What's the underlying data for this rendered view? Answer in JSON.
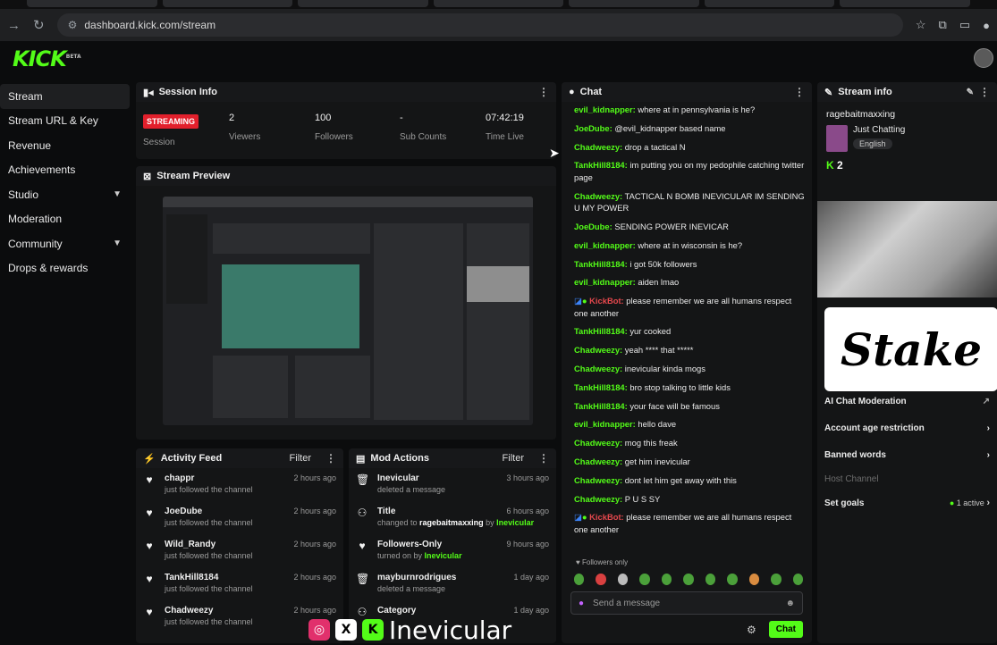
{
  "browser": {
    "url": "dashboard.kick.com/stream"
  },
  "brand": {
    "logo": "KICK",
    "beta": "BETA",
    "accent": "#53fc18"
  },
  "sidebar": {
    "items": [
      {
        "label": "Stream"
      },
      {
        "label": "Stream URL & Key"
      },
      {
        "label": "Revenue"
      },
      {
        "label": "Achievements"
      },
      {
        "label": "Studio"
      },
      {
        "label": "Moderation"
      },
      {
        "label": "Community"
      },
      {
        "label": "Drops & rewards"
      }
    ]
  },
  "session": {
    "title": "Session Info",
    "badge": "STREAMING",
    "session_label": "Session",
    "viewers": "2",
    "viewers_label": "Viewers",
    "followers": "100",
    "followers_label": "Followers",
    "subs": "-",
    "subs_label": "Sub Counts",
    "time": "07:42:19",
    "time_label": "Time Live"
  },
  "preview": {
    "title": "Stream Preview"
  },
  "activity": {
    "title": "Activity Feed",
    "filter": "Filter",
    "rows": [
      {
        "name": "chappr",
        "sub": "just followed the channel",
        "time": "2 hours ago"
      },
      {
        "name": "JoeDube",
        "sub": "just followed the channel",
        "time": "2 hours ago"
      },
      {
        "name": "Wild_Randy",
        "sub": "just followed the channel",
        "time": "2 hours ago"
      },
      {
        "name": "TankHill8184",
        "sub": "just followed the channel",
        "time": "2 hours ago"
      },
      {
        "name": "Chadweezy",
        "sub": "just followed the channel",
        "time": "2 hours ago"
      }
    ]
  },
  "mod": {
    "title": "Mod Actions",
    "filter": "Filter",
    "rows": [
      {
        "name": "Inevicular",
        "sub": "deleted a message",
        "time": "3 hours ago"
      },
      {
        "name": "Title",
        "sub_a": "changed to ",
        "sub_b": "ragebaitmaxxing",
        "sub_c": " by ",
        "sub_d": "Inevicular",
        "time": "6 hours ago"
      },
      {
        "name": "Followers-Only",
        "sub_a": "turned on by ",
        "sub_d": "Inevicular",
        "time": "9 hours ago"
      },
      {
        "name": "mayburnrodrigues",
        "sub": "deleted a message",
        "time": "1 day ago"
      },
      {
        "name": "Category",
        "sub": "",
        "time": "1 day ago"
      }
    ]
  },
  "chat": {
    "title": "Chat",
    "messages": [
      {
        "user": "evil_kidnapper:",
        "text": " where at in pennsylvania is he?"
      },
      {
        "user": "JoeDube:",
        "text": " @evil_kidnapper based name"
      },
      {
        "user": "Chadweezy:",
        "text": " drop a tactical N"
      },
      {
        "user": "TankHill8184:",
        "text": " im putting you on my pedophile catching twitter page"
      },
      {
        "user": "Chadweezy:",
        "text": " TACTICAL N BOMB INEVICULAR IM SENDING U MY POWER"
      },
      {
        "user": "JoeDube:",
        "text": " SENDING POWER INEVICAR"
      },
      {
        "user": "evil_kidnapper:",
        "text": " where at in wisconsin is he?"
      },
      {
        "user": "TankHill8184:",
        "text": " i got 50k followers"
      },
      {
        "user": "evil_kidnapper:",
        "text": " aiden lmao"
      },
      {
        "user": "KickBot:",
        "text": " please remember we are all humans respect one another",
        "bot": true
      },
      {
        "user": "TankHill8184:",
        "text": " yur cooked"
      },
      {
        "user": "Chadweezy:",
        "text": " yeah **** that *****"
      },
      {
        "user": "Chadweezy:",
        "text": " inevicular kinda mogs"
      },
      {
        "user": "TankHill8184:",
        "text": " bro stop talking to little kids"
      },
      {
        "user": "TankHill8184:",
        "text": " your face will be famous"
      },
      {
        "user": "evil_kidnapper:",
        "text": " hello dave"
      },
      {
        "user": "Chadweezy:",
        "text": " mog this freak"
      },
      {
        "user": "Chadweezy:",
        "text": " get him inevicular"
      },
      {
        "user": "Chadweezy:",
        "text": " dont let him get away with this"
      },
      {
        "user": "Chadweezy:",
        "text": " P U S SY"
      },
      {
        "user": "KickBot:",
        "text": " please remember we are all humans respect one another",
        "bot": true
      }
    ],
    "followers_only": "Followers only",
    "placeholder": "Send a message",
    "send": "Chat"
  },
  "stream_info": {
    "title": "Stream info",
    "channel": "ragebaitmaxxing",
    "category": "Just Chatting",
    "language": "English",
    "viewer_count": "2",
    "rows": [
      {
        "label": "AI Chat Moderation"
      },
      {
        "label": "Account age restriction"
      },
      {
        "label": "Banned words"
      },
      {
        "label": "Host Channel"
      },
      {
        "label": "Set goals",
        "status": "1 active"
      }
    ]
  },
  "overlay": {
    "handle": "Inevicular",
    "stake": "Stake"
  }
}
